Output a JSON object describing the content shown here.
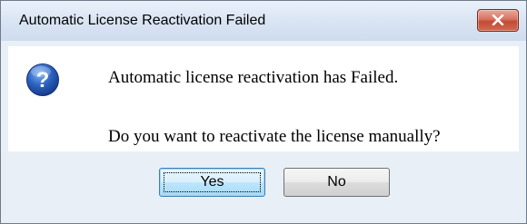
{
  "dialog": {
    "title": "Automatic License Reactivation Failed",
    "message_line1": "Automatic license reactivation has Failed.",
    "message_line2": "Do you want to reactivate the license manually?",
    "icon": "question-icon",
    "buttons": {
      "yes_label": "Yes",
      "no_label": "No"
    }
  },
  "colors": {
    "close_button": "#c44a33",
    "question_icon": "#2a62c0",
    "default_button_border": "#3c7fb1"
  }
}
